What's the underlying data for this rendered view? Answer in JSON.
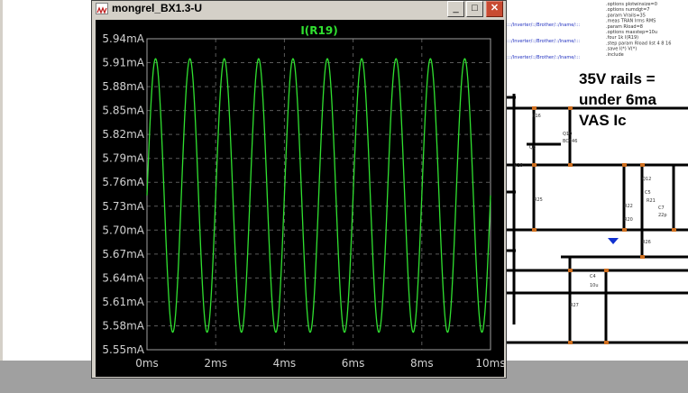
{
  "window": {
    "title": "mongrel_BX1.3-U",
    "minimize_glyph": "_",
    "maximize_glyph": "□",
    "close_glyph": "✕"
  },
  "plot": {
    "trace_label": "I(R19)",
    "trace_color": "#30e030",
    "background": "#000000"
  },
  "chart_data": {
    "type": "line",
    "title": "I(R19)",
    "xlabel": "",
    "ylabel": "",
    "x_unit": "ms",
    "y_unit": "mA",
    "xlim": [
      0,
      10
    ],
    "ylim": [
      5.55,
      5.94
    ],
    "x_ticks": [
      "0ms",
      "2ms",
      "4ms",
      "6ms",
      "8ms",
      "10ms"
    ],
    "y_ticks": [
      "5.94mA",
      "5.91mA",
      "5.88mA",
      "5.85mA",
      "5.82mA",
      "5.79mA",
      "5.76mA",
      "5.73mA",
      "5.70mA",
      "5.67mA",
      "5.64mA",
      "5.61mA",
      "5.58mA",
      "5.55mA"
    ],
    "grid": true,
    "series": [
      {
        "name": "I(R19)",
        "waveform": "sine",
        "frequency_khz": 1,
        "cycles": 10,
        "min": 5.572,
        "max": 5.915,
        "start_value": 5.743
      }
    ]
  },
  "schematic": {
    "note": [
      "35V rails =",
      "under 6ma",
      "VAS Ic"
    ],
    "directives": [
      ".options plotwinsize=0",
      ".options numdgt=7",
      ".param Vrails=35",
      ".meas TRAN Irms RMS",
      ".param Rload=8",
      ".options maxstep=10u",
      ".four 1k I(R19)",
      ".step param Rload list 4 8 16",
      ".save I(*) V(*)",
      ".include"
    ],
    "netlabels": [
      ":::/Inverter/::/Brother/::/lname/:::",
      ":::/Inverter/::/Brother/::/lname/:::",
      ":::/Inverter/::/Brother/::/lname/:::"
    ],
    "components": [
      "R16",
      "Q10",
      "BC546",
      "Q6",
      "R18",
      "Q12",
      "C5",
      "R21",
      "R22",
      "R20",
      "C7",
      "22p",
      "R25",
      "R26",
      "C4",
      "10u",
      "R27"
    ]
  }
}
